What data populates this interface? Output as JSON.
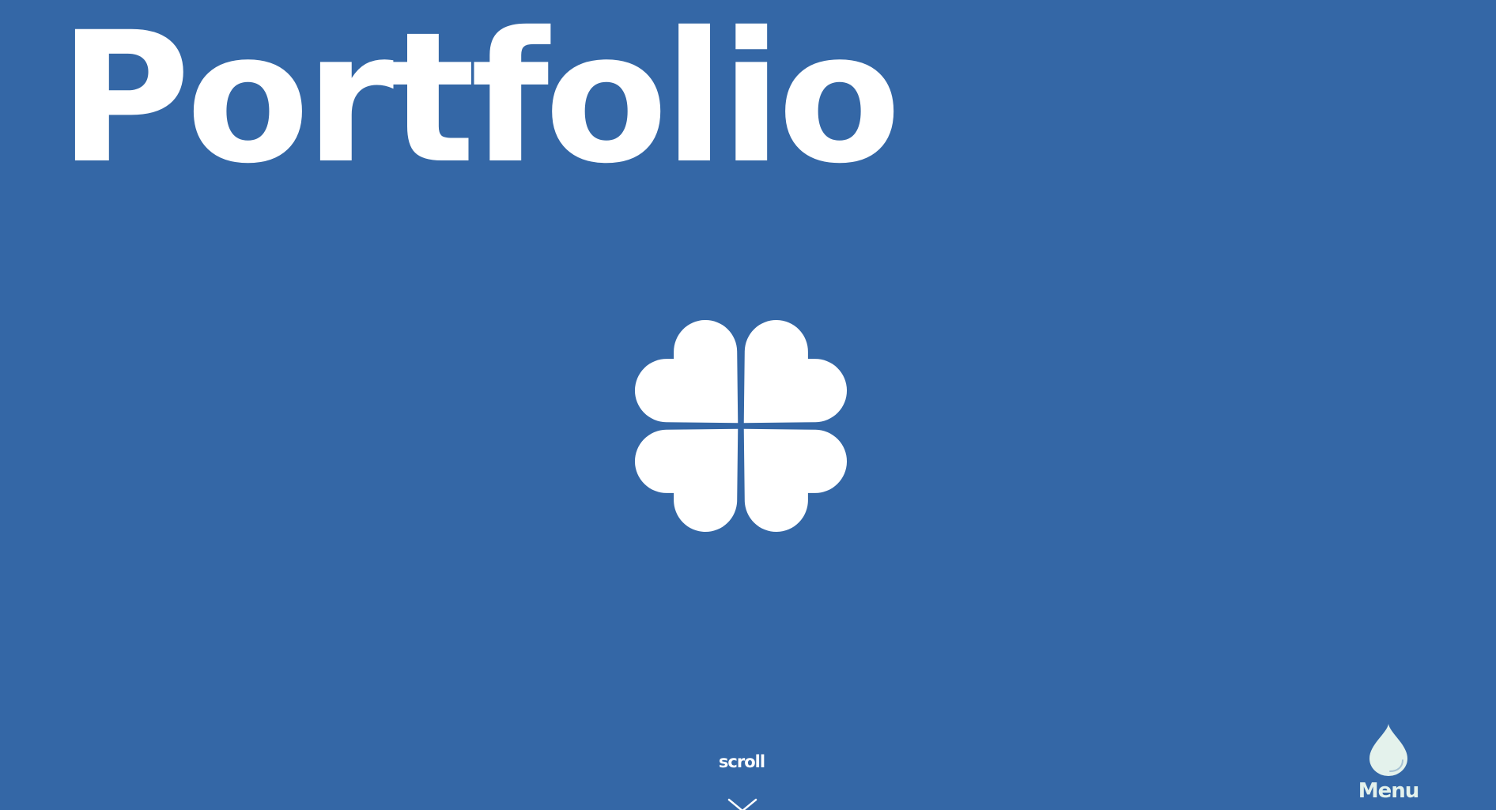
{
  "page": {
    "title": "Portfolio",
    "background_color": "#3467a6"
  },
  "logo": {
    "icon": "clover-hearts-icon",
    "color": "#ffffff"
  },
  "scroll": {
    "label": "scroll",
    "icon": "chevron-down-icon"
  },
  "menu": {
    "label": "Menu",
    "icon": "water-drop-icon",
    "color": "#e4f2ec"
  }
}
